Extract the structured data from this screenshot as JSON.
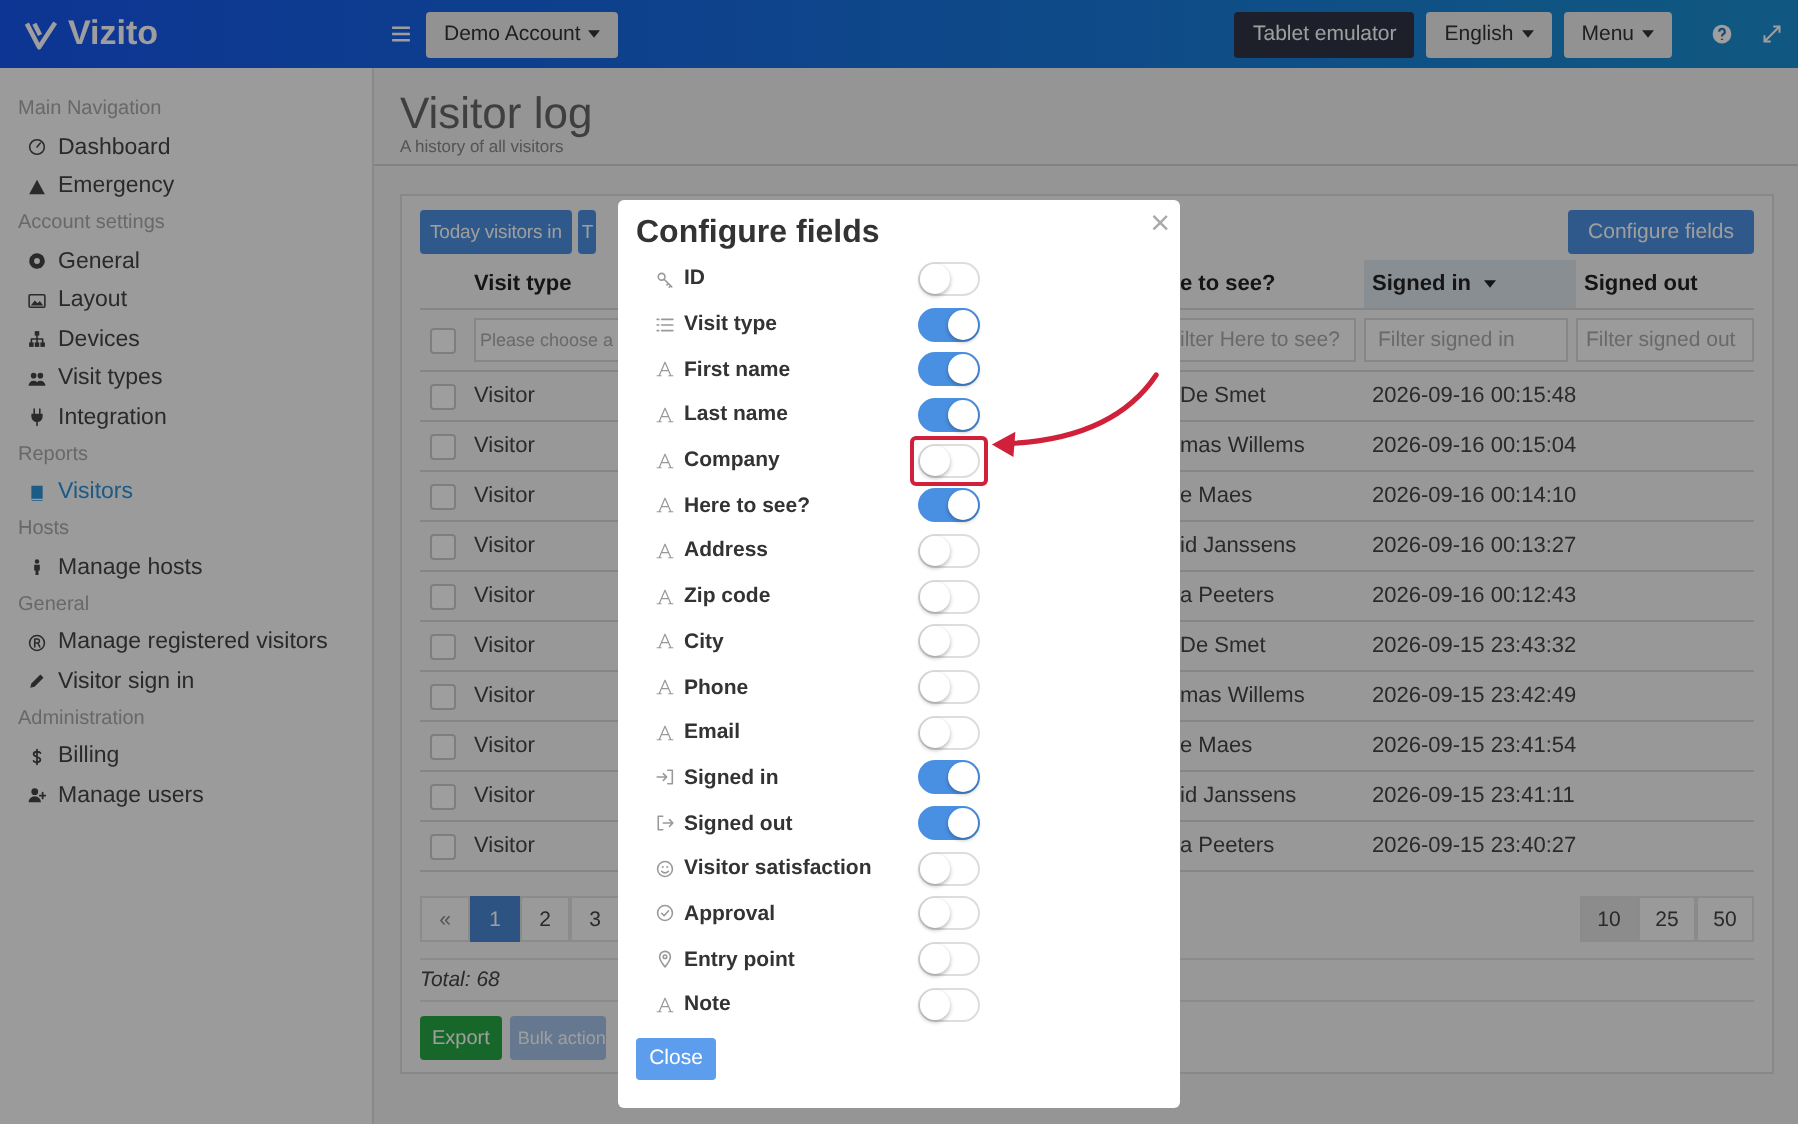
{
  "header": {
    "logo": "Vizito",
    "account_button": "Demo Account",
    "tablet_button": "Tablet emulator",
    "language_button": "English",
    "menu_button": "Menu"
  },
  "sidebar": {
    "sections": [
      {
        "title": "Main Navigation",
        "items": [
          {
            "label": "Dashboard",
            "kind": "gauge",
            "selected": false
          },
          {
            "label": "Emergency",
            "kind": "warning",
            "selected": false
          }
        ]
      },
      {
        "title": "Account settings",
        "items": [
          {
            "label": "General",
            "kind": "gear",
            "selected": false
          },
          {
            "label": "Layout",
            "kind": "image",
            "selected": false
          },
          {
            "label": "Devices",
            "kind": "sitemap",
            "selected": false
          },
          {
            "label": "Visit types",
            "kind": "users",
            "selected": false
          },
          {
            "label": "Integration",
            "kind": "plug",
            "selected": false
          }
        ]
      },
      {
        "title": "Reports",
        "items": [
          {
            "label": "Visitors",
            "kind": "book",
            "selected": true
          }
        ]
      },
      {
        "title": "Hosts",
        "items": [
          {
            "label": "Manage hosts",
            "kind": "person",
            "selected": false
          }
        ]
      },
      {
        "title": "General",
        "items": [
          {
            "label": "Manage registered visitors",
            "kind": "registered",
            "selected": false
          },
          {
            "label": "Visitor sign in",
            "kind": "pencil",
            "selected": false
          }
        ]
      },
      {
        "title": "Administration",
        "items": [
          {
            "label": "Billing",
            "kind": "dollar",
            "selected": false
          },
          {
            "label": "Manage users",
            "kind": "user-plus",
            "selected": false
          }
        ]
      }
    ]
  },
  "page": {
    "title": "Visitor log",
    "subtitle": "A history of all visitors"
  },
  "toolbar": {
    "buttons": [
      "Today visitors in",
      "T"
    ],
    "configure_button": "Configure fields"
  },
  "table": {
    "select_all_checked": false,
    "columns": [
      {
        "label": "Visit type",
        "sorted": false
      },
      {
        "label": "e to see?",
        "sorted": false
      },
      {
        "label": "Signed in",
        "sorted": true
      },
      {
        "label": "Signed out",
        "sorted": false
      }
    ],
    "filters": [
      {
        "kind": "select",
        "placeholder": "Please choose a"
      },
      {
        "kind": "text",
        "placeholder": "ilter Here to see?"
      },
      {
        "kind": "text",
        "placeholder": "Filter signed in"
      },
      {
        "kind": "text",
        "placeholder": "Filter signed out"
      }
    ],
    "rows": [
      {
        "checked": false,
        "visit_type": "Visitor",
        "column_3": "De Smet",
        "signed_in": "2026-09-16 00:15:48"
      },
      {
        "checked": false,
        "visit_type": "Visitor",
        "column_3": "mas Willems",
        "signed_in": "2026-09-16 00:15:04"
      },
      {
        "checked": false,
        "visit_type": "Visitor",
        "column_3": "e Maes",
        "signed_in": "2026-09-16 00:14:10"
      },
      {
        "checked": false,
        "visit_type": "Visitor",
        "column_3": "id Janssens",
        "signed_in": "2026-09-16 00:13:27"
      },
      {
        "checked": false,
        "visit_type": "Visitor",
        "column_3": "a Peeters",
        "signed_in": "2026-09-16 00:12:43"
      },
      {
        "checked": false,
        "visit_type": "Visitor",
        "column_3": "De Smet",
        "signed_in": "2026-09-15 23:43:32"
      },
      {
        "checked": false,
        "visit_type": "Visitor",
        "column_3": "mas Willems",
        "signed_in": "2026-09-15 23:42:49"
      },
      {
        "checked": false,
        "visit_type": "Visitor",
        "column_3": "e Maes",
        "signed_in": "2026-09-15 23:41:54"
      },
      {
        "checked": false,
        "visit_type": "Visitor",
        "column_3": "id Janssens",
        "signed_in": "2026-09-15 23:41:11"
      },
      {
        "checked": false,
        "visit_type": "Visitor",
        "column_3": "a Peeters",
        "signed_in": "2026-09-15 23:40:27"
      }
    ]
  },
  "pagination": {
    "prev": "«",
    "pages": [
      {
        "label": "1",
        "selected": true
      },
      {
        "label": "2",
        "selected": false
      },
      {
        "label": "3",
        "selected": false
      }
    ],
    "page_sizes": [
      {
        "label": "10",
        "selected": true
      },
      {
        "label": "25",
        "selected": false
      },
      {
        "label": "50",
        "selected": false
      }
    ]
  },
  "footer": {
    "total": "Total: 68",
    "export_button": "Export",
    "bulk_button": {
      "label": "Bulk action",
      "disabled": true
    }
  },
  "modal": {
    "title": "Configure fields",
    "close": "×",
    "close_button": "Close",
    "fields": [
      {
        "label": "ID",
        "kind": "key",
        "on": false,
        "highlighted": false
      },
      {
        "label": "Visit type",
        "kind": "list",
        "on": true,
        "highlighted": false
      },
      {
        "label": "First name",
        "kind": "text",
        "on": true,
        "highlighted": false
      },
      {
        "label": "Last name",
        "kind": "text",
        "on": true,
        "highlighted": false
      },
      {
        "label": "Company",
        "kind": "text",
        "on": false,
        "highlighted": true
      },
      {
        "label": "Here to see?",
        "kind": "text",
        "on": true,
        "highlighted": false
      },
      {
        "label": "Address",
        "kind": "text",
        "on": false,
        "highlighted": false
      },
      {
        "label": "Zip code",
        "kind": "text",
        "on": false,
        "highlighted": false
      },
      {
        "label": "City",
        "kind": "text",
        "on": false,
        "highlighted": false
      },
      {
        "label": "Phone",
        "kind": "text",
        "on": false,
        "highlighted": false
      },
      {
        "label": "Email",
        "kind": "text",
        "on": false,
        "highlighted": false
      },
      {
        "label": "Signed in",
        "kind": "sign-in",
        "on": true,
        "highlighted": false
      },
      {
        "label": "Signed out",
        "kind": "sign-out",
        "on": true,
        "highlighted": false
      },
      {
        "label": "Visitor satisfaction",
        "kind": "smiley",
        "on": false,
        "highlighted": false
      },
      {
        "label": "Approval",
        "kind": "check-circle",
        "on": false,
        "highlighted": false
      },
      {
        "label": "Entry point",
        "kind": "pin",
        "on": false,
        "highlighted": false
      },
      {
        "label": "Note",
        "kind": "text",
        "on": false,
        "highlighted": false
      }
    ]
  }
}
